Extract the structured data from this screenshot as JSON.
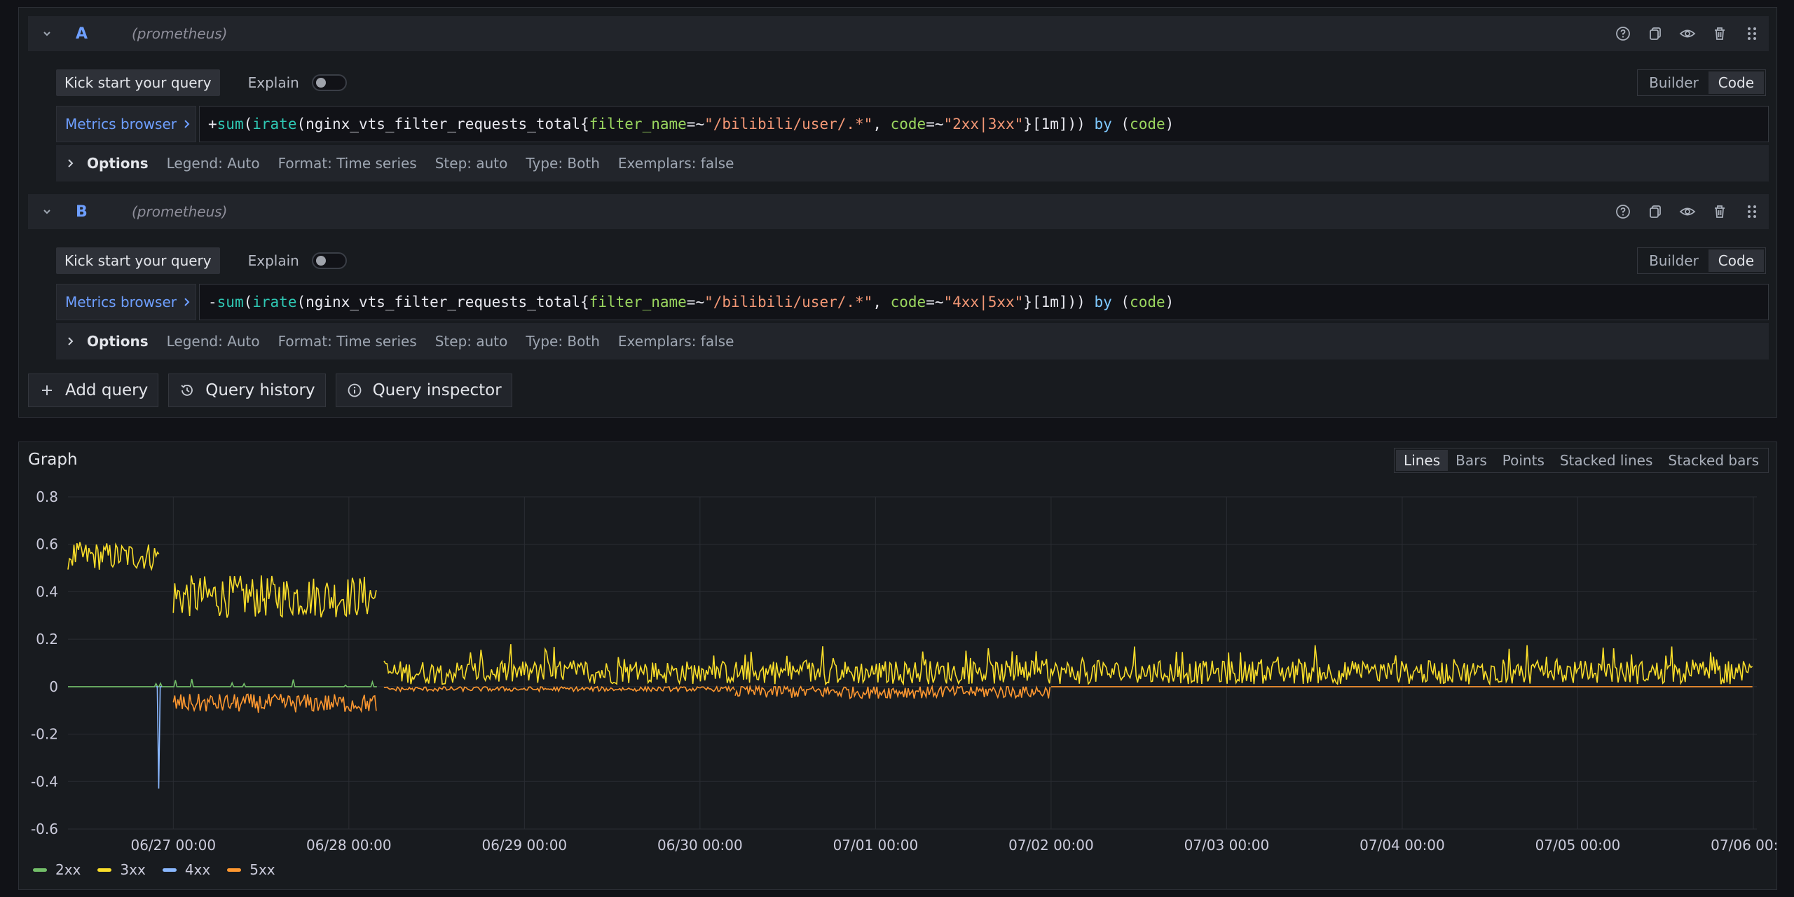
{
  "queries": [
    {
      "name": "A",
      "datasource": "(prometheus)",
      "kick_start_label": "Kick start your query",
      "explain_label": "Explain",
      "builder_label": "Builder",
      "code_label": "Code",
      "metrics_browser_label": "Metrics browser",
      "expr": {
        "prefix": "+",
        "fn1": "sum",
        "fn2": "irate",
        "metric": "nginx_vts_filter_requests_total",
        "label1": "filter_name",
        "op1": "=~",
        "val1": "\"/bilibili/user/.*\"",
        "label2": "code",
        "op2": "=~",
        "val2": "\"2xx|3xx\"",
        "range": "[1m]",
        "by": "by",
        "bylabel": "code"
      },
      "options_label": "Options",
      "legend": "Legend: Auto",
      "format": "Format: Time series",
      "step": "Step: auto",
      "type": "Type: Both",
      "exemplars": "Exemplars: false"
    },
    {
      "name": "B",
      "datasource": "(prometheus)",
      "kick_start_label": "Kick start your query",
      "explain_label": "Explain",
      "builder_label": "Builder",
      "code_label": "Code",
      "metrics_browser_label": "Metrics browser",
      "expr": {
        "prefix": "-",
        "fn1": "sum",
        "fn2": "irate",
        "metric": "nginx_vts_filter_requests_total",
        "label1": "filter_name",
        "op1": "=~",
        "val1": "\"/bilibili/user/.*\"",
        "label2": "code",
        "op2": "=~",
        "val2": "\"4xx|5xx\"",
        "range": "[1m]",
        "by": "by",
        "bylabel": "code"
      },
      "options_label": "Options",
      "legend": "Legend: Auto",
      "format": "Format: Time series",
      "step": "Step: auto",
      "type": "Type: Both",
      "exemplars": "Exemplars: false"
    }
  ],
  "actions": {
    "add_query": "Add query",
    "query_history": "Query history",
    "query_inspector": "Query inspector"
  },
  "graph": {
    "title": "Graph",
    "modes": [
      "Lines",
      "Bars",
      "Points",
      "Stacked lines",
      "Stacked bars"
    ],
    "active_mode": "Lines"
  },
  "chart_data": {
    "type": "line",
    "title": "",
    "xlabel": "",
    "ylabel": "",
    "ylim": [
      -0.6,
      0.8
    ],
    "yticks": [
      "0.8",
      "0.6",
      "0.4",
      "0.2",
      "0",
      "-0.2",
      "-0.4",
      "-0.6"
    ],
    "xticks": [
      "06/27 00:00",
      "06/28 00:00",
      "06/29 00:00",
      "06/30 00:00",
      "07/01 00:00",
      "07/02 00:00",
      "07/03 00:00",
      "07/04 00:00",
      "07/05 00:00",
      "07/06 00:00"
    ],
    "xrange_days": [
      -0.6,
      9.02
    ],
    "grid": true,
    "legend_position": "bottom-left",
    "series": [
      {
        "name": "2xx",
        "color": "#73bf69",
        "segments": [
          {
            "x_days": [
              -0.6,
              1.16
            ],
            "baseline": 0.0,
            "spike_prob": 0.06,
            "spike_max": 0.05
          }
        ]
      },
      {
        "name": "3xx",
        "color": "#fade2a",
        "segments": [
          {
            "x_days": [
              -0.6,
              -0.08
            ],
            "mean": 0.55,
            "noise": 0.06
          },
          {
            "x_days": [
              0.0,
              1.16
            ],
            "mean": 0.38,
            "noise": 0.09
          },
          {
            "x_days": [
              1.2,
              9.0
            ],
            "mean": 0.06,
            "noise": 0.05
          }
        ]
      },
      {
        "name": "4xx",
        "color": "#8ab8ff",
        "segments": [
          {
            "x_days": [
              -0.1,
              -0.06
            ],
            "min": -0.43
          }
        ]
      },
      {
        "name": "5xx",
        "color": "#ff9830",
        "segments": [
          {
            "x_days": [
              0.0,
              1.16
            ],
            "mean": -0.07,
            "noise": 0.04
          },
          {
            "x_days": [
              1.2,
              3.2
            ],
            "mean": -0.01,
            "noise": 0.01
          },
          {
            "x_days": [
              3.2,
              5.0
            ],
            "mean": -0.02,
            "noise": 0.03
          },
          {
            "x_days": [
              5.0,
              9.0
            ],
            "mean": 0.0,
            "noise": 0.0
          }
        ]
      }
    ]
  }
}
